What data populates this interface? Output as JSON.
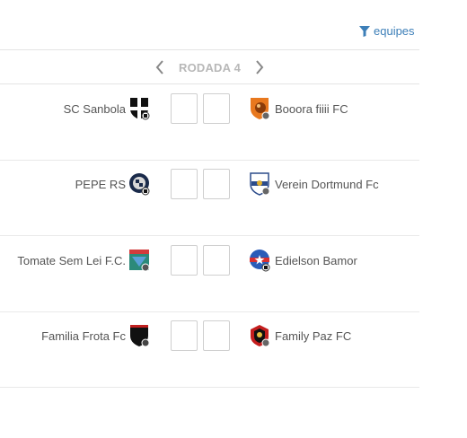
{
  "filter": {
    "label": "equipes",
    "icon": "filter-icon",
    "color": "#3d7fb8"
  },
  "round": {
    "label": "RODADA 4",
    "prev_icon": "chevron-left-icon",
    "next_icon": "chevron-right-icon"
  },
  "matches": [
    {
      "home": {
        "name": "SC Sanbola",
        "crest": "crest-icon"
      },
      "away": {
        "name": "Booora fiiii FC",
        "crest": "crest-icon"
      },
      "home_score": "",
      "away_score": ""
    },
    {
      "home": {
        "name": "PEPE RS",
        "crest": "crest-icon"
      },
      "away": {
        "name": "Verein Dortmund Fc",
        "crest": "crest-icon"
      },
      "home_score": "",
      "away_score": ""
    },
    {
      "home": {
        "name": "Tomate Sem Lei F.C.",
        "crest": "crest-icon"
      },
      "away": {
        "name": "Edielson Bamor",
        "crest": "crest-icon"
      },
      "home_score": "",
      "away_score": ""
    },
    {
      "home": {
        "name": "Familia Frota Fc",
        "crest": "crest-icon"
      },
      "away": {
        "name": "Family Paz FC",
        "crest": "crest-icon"
      },
      "home_score": "",
      "away_score": ""
    }
  ]
}
